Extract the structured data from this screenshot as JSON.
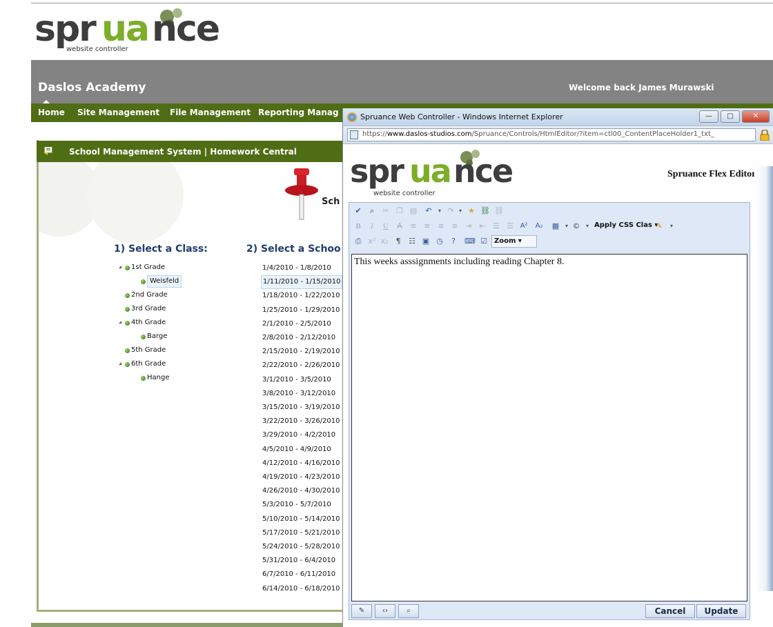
{
  "site": {
    "logo": {
      "word_a": "spr",
      "word_b": "ua",
      "word_c": "nce",
      "tagline": "website controller"
    },
    "school_name": "Daslos Academy",
    "welcome": "Welcome back James Murawski",
    "nav": [
      "Home",
      "Site Management",
      "File Management",
      "Reporting Manag"
    ]
  },
  "panel": {
    "title": "School Management System | Homework Central",
    "pin_label": "Sch",
    "class_heading": "1) Select a Class:",
    "week_heading": "2) Select a Schoo",
    "classes": [
      {
        "label": "1st Grade",
        "expanded": true
      },
      {
        "label": "Weisfeld",
        "selected": true
      },
      {
        "label": "2nd Grade"
      },
      {
        "label": "3rd Grade"
      },
      {
        "label": "4th Grade",
        "expanded": true
      },
      {
        "label": "Barge"
      },
      {
        "label": "5th Grade"
      },
      {
        "label": "6th Grade",
        "expanded": true
      },
      {
        "label": "Hange"
      }
    ],
    "weeks": [
      "1/4/2010 - 1/8/2010",
      "1/11/2010 - 1/15/2010",
      "1/18/2010 - 1/22/2010",
      "1/25/2010 - 1/29/2010",
      "2/1/2010 - 2/5/2010",
      "2/8/2010 - 2/12/2010",
      "2/15/2010 - 2/19/2010",
      "2/22/2010 - 2/26/2010",
      "3/1/2010 - 3/5/2010",
      "3/8/2010 - 3/12/2010",
      "3/15/2010 - 3/19/2010",
      "3/22/2010 - 3/26/2010",
      "3/29/2010 - 4/2/2010",
      "4/5/2010 - 4/9/2010",
      "4/12/2010 - 4/16/2010",
      "4/19/2010 - 4/23/2010",
      "4/26/2010 - 4/30/2010",
      "5/3/2010 - 5/7/2010",
      "5/10/2010 - 5/14/2010",
      "5/17/2010 - 5/21/2010",
      "5/24/2010 - 5/28/2010",
      "5/31/2010 - 6/4/2010",
      "6/7/2010 - 6/11/2010",
      "6/14/2010 - 6/18/2010"
    ],
    "selected_week_index": 1
  },
  "popup": {
    "window_title": "Spruance Web Controller - Windows Internet Explorer",
    "url_scheme": "https://",
    "url_host": "www.daslos-studios.com",
    "url_path": "/Spruance/Controls/HtmlEditor/?item=ctl00_ContentPlaceHolder1_txt_",
    "editor_label": "Spruance Flex Editor",
    "toolbar": {
      "css_class_dropdown": "Apply CSS Clas",
      "zoom_dropdown": "Zoom"
    },
    "content": "This weeks asssignments including reading Chapter 8.",
    "cancel_label": "Cancel",
    "update_label": "Update"
  },
  "colors": {
    "nav_green": "#4f6d14",
    "header_gray": "#838383",
    "heading_blue": "#1f3b6e",
    "logo_green": "#7cae2a"
  },
  "icons": [
    "panel-icon",
    "pushpin-icon",
    "ie-icon",
    "lock-icon",
    "page-icon",
    "spellcheck-icon",
    "find-icon",
    "cut-icon",
    "copy-icon",
    "paste-icon",
    "undo-icon",
    "redo-icon",
    "favorite-icon",
    "link-icon",
    "unlink-icon",
    "bold-icon",
    "italic-icon",
    "underline-icon",
    "strike-icon",
    "print-icon",
    "design-mode-icon",
    "html-mode-icon",
    "preview-mode-icon"
  ]
}
